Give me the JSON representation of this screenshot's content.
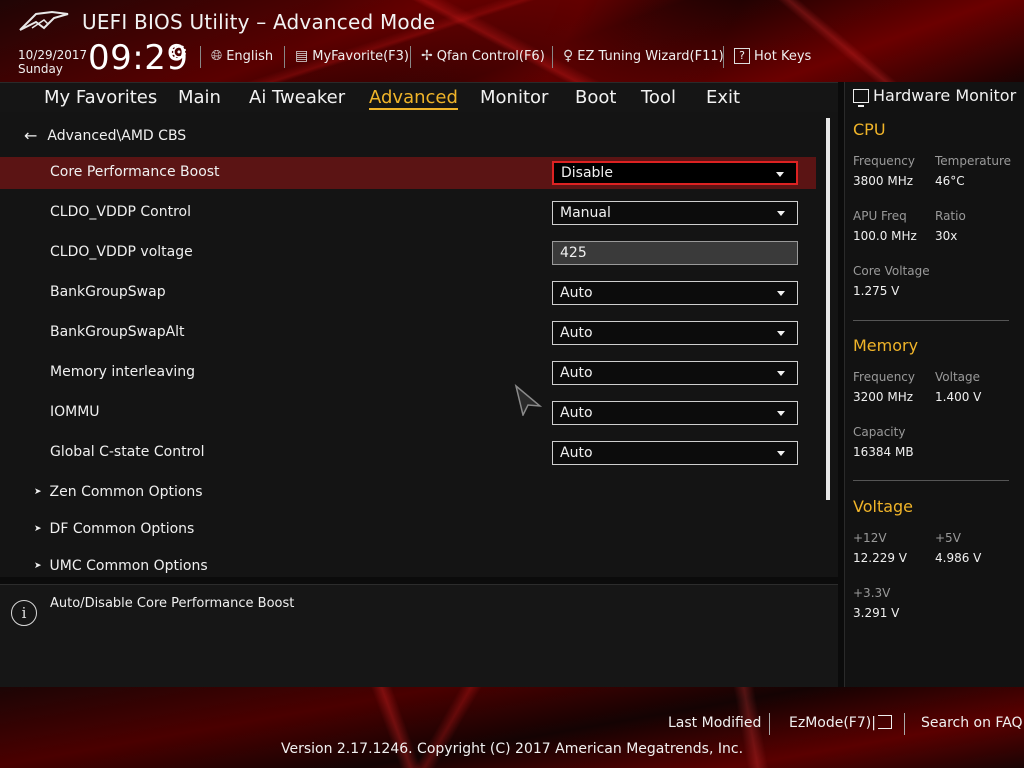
{
  "header": {
    "title": "UEFI BIOS Utility – Advanced Mode",
    "date": "10/29/2017",
    "day": "Sunday",
    "time": "09:29",
    "items": {
      "language": "English",
      "myfavorite": "MyFavorite(F3)",
      "qfan": "Qfan Control(F6)",
      "ez_tuning": "EZ Tuning Wizard(F11)",
      "hotkeys": "Hot Keys"
    }
  },
  "tabs": [
    "My Favorites",
    "Main",
    "Ai Tweaker",
    "Advanced",
    "Monitor",
    "Boot",
    "Tool",
    "Exit"
  ],
  "active_tab": "Advanced",
  "breadcrumb": "Advanced\\AMD CBS",
  "settings": [
    {
      "label": "Core Performance Boost",
      "value": "Disable",
      "type": "dropdown",
      "selected": true
    },
    {
      "label": "CLDO_VDDP Control",
      "value": "Manual",
      "type": "dropdown"
    },
    {
      "label": "CLDO_VDDP voltage",
      "value": "425",
      "type": "input"
    },
    {
      "label": "BankGroupSwap",
      "value": "Auto",
      "type": "dropdown"
    },
    {
      "label": "BankGroupSwapAlt",
      "value": "Auto",
      "type": "dropdown"
    },
    {
      "label": "Memory interleaving",
      "value": "Auto",
      "type": "dropdown"
    },
    {
      "label": "IOMMU",
      "value": "Auto",
      "type": "dropdown"
    },
    {
      "label": "Global C-state Control",
      "value": "Auto",
      "type": "dropdown"
    }
  ],
  "submenus": [
    "Zen Common Options",
    "DF Common Options",
    "UMC Common Options"
  ],
  "help_text": "Auto/Disable Core Performance Boost",
  "hardware_monitor": {
    "title": "Hardware Monitor",
    "cpu": {
      "heading": "CPU",
      "frequency_label": "Frequency",
      "frequency": "3800 MHz",
      "temperature_label": "Temperature",
      "temperature": "46°C",
      "apu_freq_label": "APU Freq",
      "apu_freq": "100.0 MHz",
      "ratio_label": "Ratio",
      "ratio": "30x",
      "core_voltage_label": "Core Voltage",
      "core_voltage": "1.275 V"
    },
    "memory": {
      "heading": "Memory",
      "frequency_label": "Frequency",
      "frequency": "3200 MHz",
      "voltage_label": "Voltage",
      "voltage": "1.400 V",
      "capacity_label": "Capacity",
      "capacity": "16384 MB"
    },
    "voltage": {
      "heading": "Voltage",
      "v12_label": "+12V",
      "v12": "12.229 V",
      "v5_label": "+5V",
      "v5": "4.986 V",
      "v33_label": "+3.3V",
      "v33": "3.291 V"
    }
  },
  "footer": {
    "last_modified": "Last Modified",
    "ezmode": "EzMode(F7)|",
    "search_faq": "Search on FAQ",
    "copyright": "Version 2.17.1246. Copyright (C) 2017 American Megatrends, Inc."
  },
  "colors": {
    "accent": "#f0b429",
    "selected_row": "#5b1414",
    "selected_border": "#dd2222"
  }
}
